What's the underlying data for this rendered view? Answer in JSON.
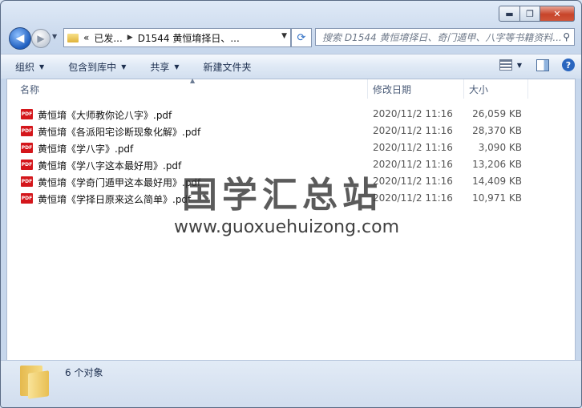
{
  "window": {
    "caption_buttons": {
      "minimize": "▬",
      "maximize": "❐",
      "close": "✕"
    }
  },
  "nav": {
    "back_glyph": "◀",
    "forward_glyph": "▶",
    "breadcrumb": [
      "«",
      "已发...",
      "D1544 黄恒堉择日、..."
    ],
    "search_placeholder": "搜索 D1544 黄恒堉择日、奇门遁甲、八字等书籍资料..."
  },
  "toolbar": {
    "organize": "组织",
    "include_in_library": "包含到库中",
    "share": "共享",
    "new_folder": "新建文件夹"
  },
  "columns": {
    "name": "名称",
    "modified": "修改日期",
    "size": "大小"
  },
  "files": [
    {
      "name": "黄恒堉《大师教你论八字》.pdf",
      "modified": "2020/11/2 11:16",
      "size": "26,059 KB"
    },
    {
      "name": "黄恒堉《各派阳宅诊断现象化解》.pdf",
      "modified": "2020/11/2 11:16",
      "size": "28,370 KB"
    },
    {
      "name": "黄恒堉《学八字》.pdf",
      "modified": "2020/11/2 11:16",
      "size": "3,090 KB"
    },
    {
      "name": "黄恒堉《学八字这本最好用》.pdf",
      "modified": "2020/11/2 11:16",
      "size": "13,206 KB"
    },
    {
      "name": "黄恒堉《学奇门遁甲这本最好用》.pdf",
      "modified": "2020/11/2 11:16",
      "size": "14,409 KB"
    },
    {
      "name": "黄恒堉《学择日原来这么简单》.pdf",
      "modified": "2020/11/2 11:16",
      "size": "10,971 KB"
    }
  ],
  "file_icon_label": "PDF",
  "watermark": {
    "title": "国学汇总站",
    "url": "www.guoxuehuizong.com"
  },
  "status": {
    "count": "6 个对象"
  }
}
